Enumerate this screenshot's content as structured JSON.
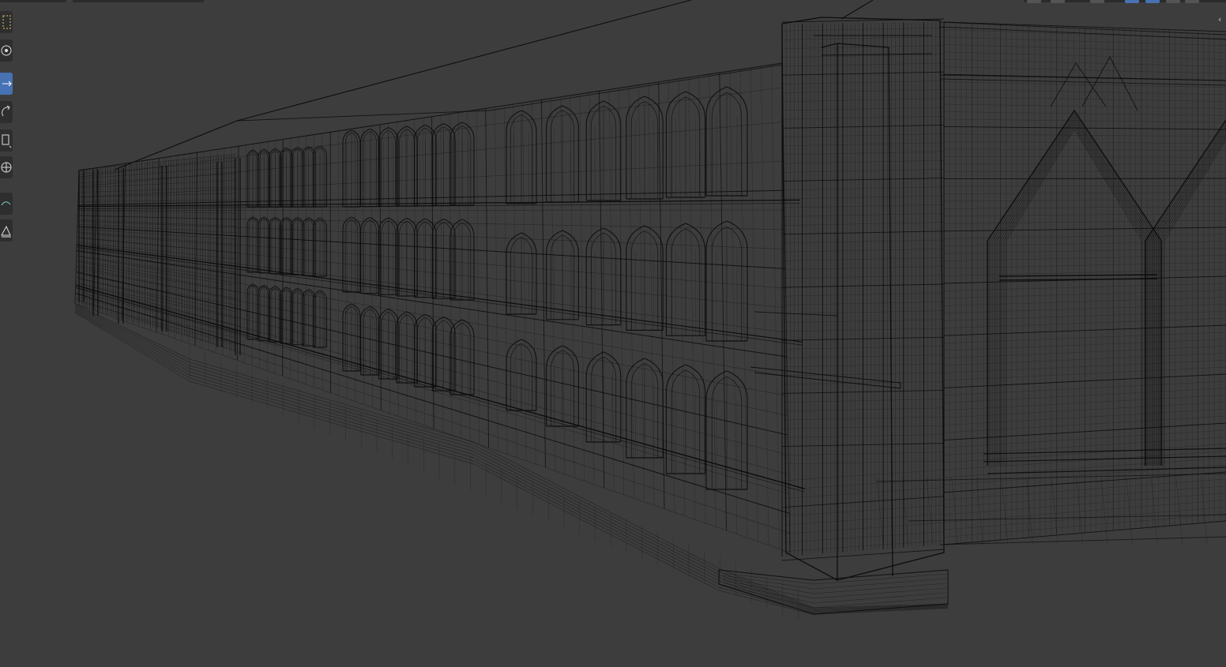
{
  "app": {
    "editor": "3D Viewport",
    "shading_mode": "wireframe"
  },
  "colors": {
    "viewport_bg": "#3d3d3d",
    "wire": "#0b0b0b",
    "toolbar_bg": "#2e2e2e",
    "active_tool": "#4772b3",
    "header_bg": "#2b2b2b"
  },
  "toolbar": {
    "tools": [
      {
        "name": "select-box",
        "icon": "select-box-icon",
        "active": false
      },
      {
        "name": "cursor",
        "icon": "cursor-icon",
        "active": false
      },
      {
        "name": "move",
        "icon": "move-icon",
        "active": true
      },
      {
        "name": "rotate",
        "icon": "rotate-icon",
        "active": false
      },
      {
        "name": "scale",
        "icon": "scale-icon",
        "active": false
      },
      {
        "name": "transform",
        "icon": "transform-icon",
        "active": false
      },
      {
        "name": "annotate",
        "icon": "annotate-icon",
        "active": false
      },
      {
        "name": "measure",
        "icon": "measure-icon",
        "active": false
      }
    ]
  },
  "header": {
    "right_buttons": [
      {
        "icon": "view-icon",
        "active": false
      },
      {
        "icon": "overlay-icon",
        "active": false
      },
      {
        "icon": "gizmo-icon",
        "active": false
      },
      {
        "icon": "wireframe-shading-icon",
        "active": true
      },
      {
        "icon": "solid-shading-icon",
        "active": true
      },
      {
        "icon": "material-shading-icon",
        "active": false
      },
      {
        "icon": "rendered-shading-icon",
        "active": false
      }
    ]
  },
  "scene": {
    "object": "gothic-building-facade",
    "floors": 3,
    "arched_windows_per_floor_near": 6,
    "arched_windows_per_floor_far": 7
  }
}
